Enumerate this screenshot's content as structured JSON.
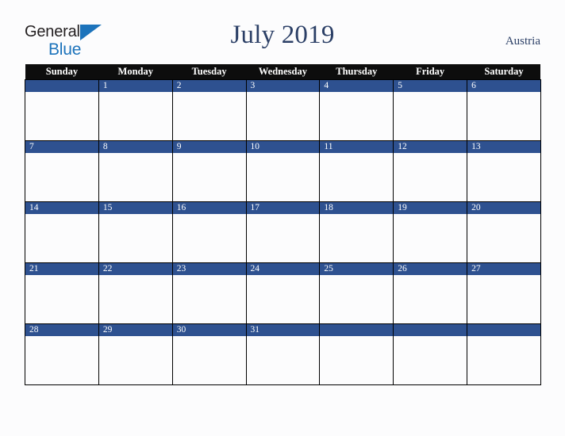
{
  "brand": {
    "word_one": "General",
    "word_two": "Blue",
    "triangle_icon": "blue-triangle-icon",
    "color_dark": "#231f20",
    "color_blue": "#1c73bb"
  },
  "header": {
    "title": "July 2019",
    "region": "Austria",
    "title_color": "#2b3f66"
  },
  "calendar": {
    "month": "July",
    "year": "2019",
    "weekday_headers": [
      "Sunday",
      "Monday",
      "Tuesday",
      "Wednesday",
      "Thursday",
      "Friday",
      "Saturday"
    ],
    "header_bg": "#0d0d0d",
    "daynum_bg": "#2e5190",
    "cell_bg": "#fcfcfd",
    "weeks": [
      {
        "days": [
          {
            "num": ""
          },
          {
            "num": "1"
          },
          {
            "num": "2"
          },
          {
            "num": "3"
          },
          {
            "num": "4"
          },
          {
            "num": "5"
          },
          {
            "num": "6"
          }
        ]
      },
      {
        "days": [
          {
            "num": "7"
          },
          {
            "num": "8"
          },
          {
            "num": "9"
          },
          {
            "num": "10"
          },
          {
            "num": "11"
          },
          {
            "num": "12"
          },
          {
            "num": "13"
          }
        ]
      },
      {
        "days": [
          {
            "num": "14"
          },
          {
            "num": "15"
          },
          {
            "num": "16"
          },
          {
            "num": "17"
          },
          {
            "num": "18"
          },
          {
            "num": "19"
          },
          {
            "num": "20"
          }
        ]
      },
      {
        "days": [
          {
            "num": "21"
          },
          {
            "num": "22"
          },
          {
            "num": "23"
          },
          {
            "num": "24"
          },
          {
            "num": "25"
          },
          {
            "num": "26"
          },
          {
            "num": "27"
          }
        ]
      },
      {
        "days": [
          {
            "num": "28"
          },
          {
            "num": "29"
          },
          {
            "num": "30"
          },
          {
            "num": "31"
          },
          {
            "num": ""
          },
          {
            "num": ""
          },
          {
            "num": ""
          }
        ]
      }
    ]
  }
}
